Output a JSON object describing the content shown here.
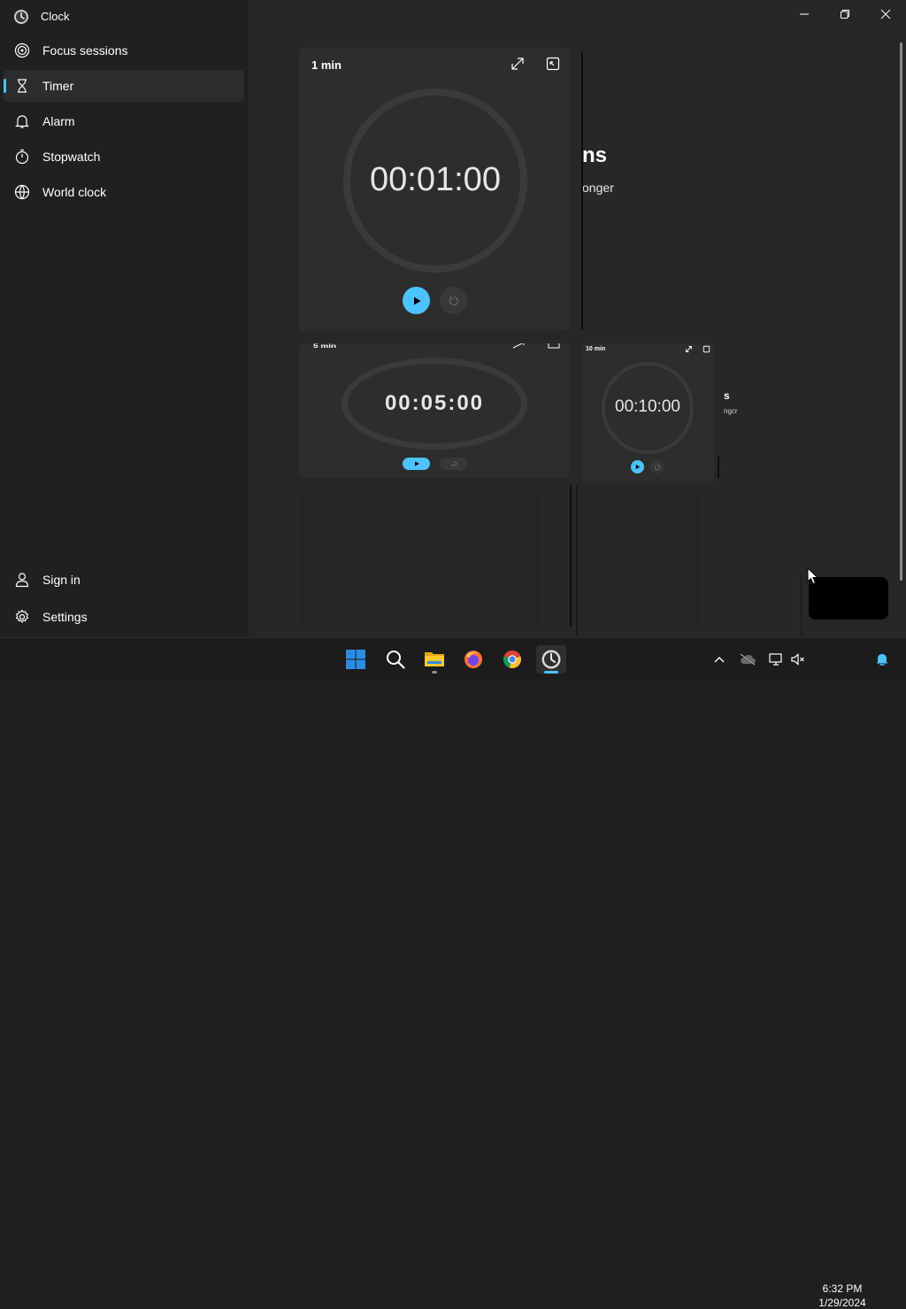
{
  "window": {
    "title": "Clock"
  },
  "sidebar": {
    "items": [
      {
        "label": "Focus sessions",
        "icon": "focus-icon",
        "active": false
      },
      {
        "label": "Timer",
        "icon": "hourglass-icon",
        "active": true
      },
      {
        "label": "Alarm",
        "icon": "bell-icon",
        "active": false
      },
      {
        "label": "Stopwatch",
        "icon": "stopwatch-icon",
        "active": false
      },
      {
        "label": "World clock",
        "icon": "globe-icon",
        "active": false
      }
    ],
    "bottom": [
      {
        "label": "Sign in",
        "icon": "person-icon"
      },
      {
        "label": "Settings",
        "icon": "gear-icon"
      }
    ]
  },
  "background_text": {
    "heading_fragment": "ns",
    "sub_fragment": "onger",
    "small_heading_fragment": "s",
    "small_sub_fragment": "ngcr"
  },
  "timers": [
    {
      "name": "1 min",
      "time": "00:01:00"
    },
    {
      "name": "5 min",
      "time": "00:05:00"
    },
    {
      "name": "10 min",
      "time": "00:10:00"
    }
  ],
  "taskbar": {
    "apps": [
      "windows-start-icon",
      "search-icon",
      "file-explorer-icon",
      "firefox-icon",
      "chrome-icon",
      "clock-app-icon"
    ],
    "time": "6:32 PM",
    "date": "1/29/2024"
  },
  "colors": {
    "accent": "#4cc2ff",
    "sidebar_bg": "#202020",
    "main_bg": "#272727",
    "card_bg": "#2d2d2d"
  }
}
